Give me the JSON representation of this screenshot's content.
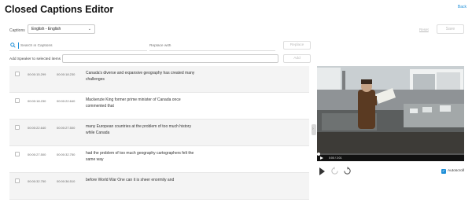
{
  "header": {
    "title": "Closed Captions Editor",
    "back_label": "Back"
  },
  "captions": {
    "label": "Captions",
    "selected": "English - English"
  },
  "actions": {
    "reset_label": "Reset",
    "save_label": "Save"
  },
  "search": {
    "placeholder": "Search in Captions",
    "replace_placeholder": "Replace with",
    "replace_button": "Replace"
  },
  "speaker": {
    "label": "Add Speaker to selected items",
    "add_button": "Add"
  },
  "rows": [
    {
      "start": "00:00:15.299",
      "end": "00:00:18.230",
      "text": "Canada's diverse and expansive geography has created many challenges"
    },
    {
      "start": "00:00:18.230",
      "end": "00:00:22.640",
      "text": "Mackenzie King former prime minister of Canada once commented that"
    },
    {
      "start": "00:00:22.640",
      "end": "00:00:27.500",
      "text": "many European countries at the problem of too much history while Canada"
    },
    {
      "start": "00:00:27.500",
      "end": "00:00:32.750",
      "text": "had the problem of too much geography cartographers felt the same way"
    },
    {
      "start": "00:00:32.750",
      "end": "00:00:36.510",
      "text": "before World War One can it is sheer enormity and"
    }
  ],
  "player": {
    "time": "0:00 / 2:01",
    "progress": 0,
    "autoscroll_label": "Autoscroll",
    "autoscroll_checked": true
  },
  "colors": {
    "accent": "#1e8fd8"
  }
}
